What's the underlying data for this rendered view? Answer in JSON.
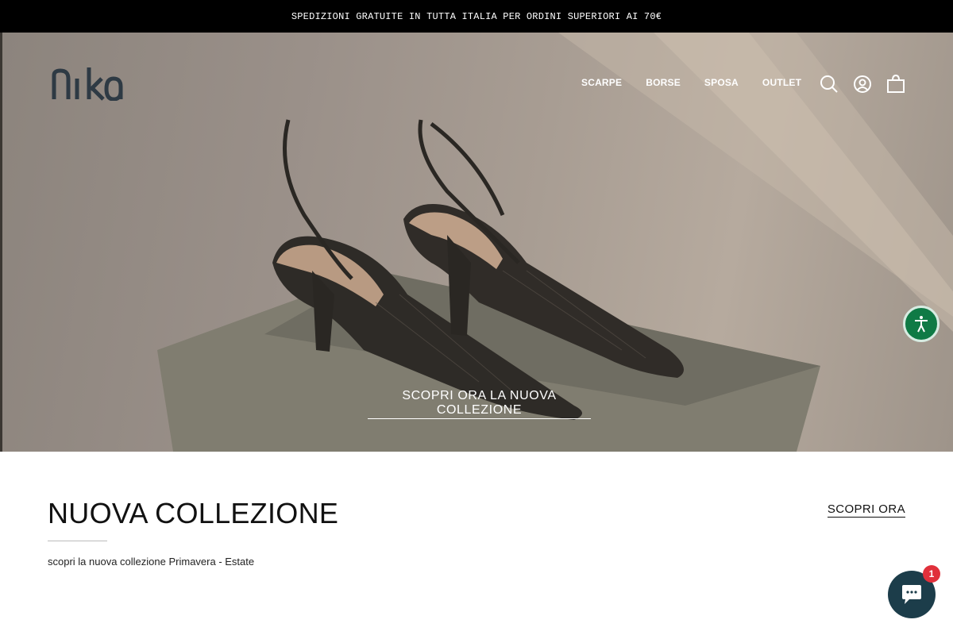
{
  "announcement": {
    "text": "SPEDIZIONI GRATUITE IN TUTTA ITALIA PER ORDINI SUPERIORI AI 70€"
  },
  "header": {
    "logo_text": "nika",
    "nav": [
      "SCARPE",
      "BORSE",
      "SPOSA",
      "OUTLET"
    ],
    "icons": [
      "search-icon",
      "account-icon",
      "cart-icon"
    ]
  },
  "hero": {
    "cta_label": "SCOPRI ORA LA NUOVA COLLEZIONE"
  },
  "section": {
    "title": "NUOVA COLLEZIONE",
    "subtitle": "scopri la nuova collezione Primavera - Estate",
    "link_label": "SCOPRI ORA"
  },
  "widgets": {
    "accessibility_icon": "accessibility-icon",
    "chat_icon": "chat-icon",
    "chat_badge": "1"
  },
  "colors": {
    "announcement_bg": "#000000",
    "accessibility_green": "#0f7a45",
    "chat_bg": "#1c3d4a",
    "badge_red": "#e0303b"
  }
}
